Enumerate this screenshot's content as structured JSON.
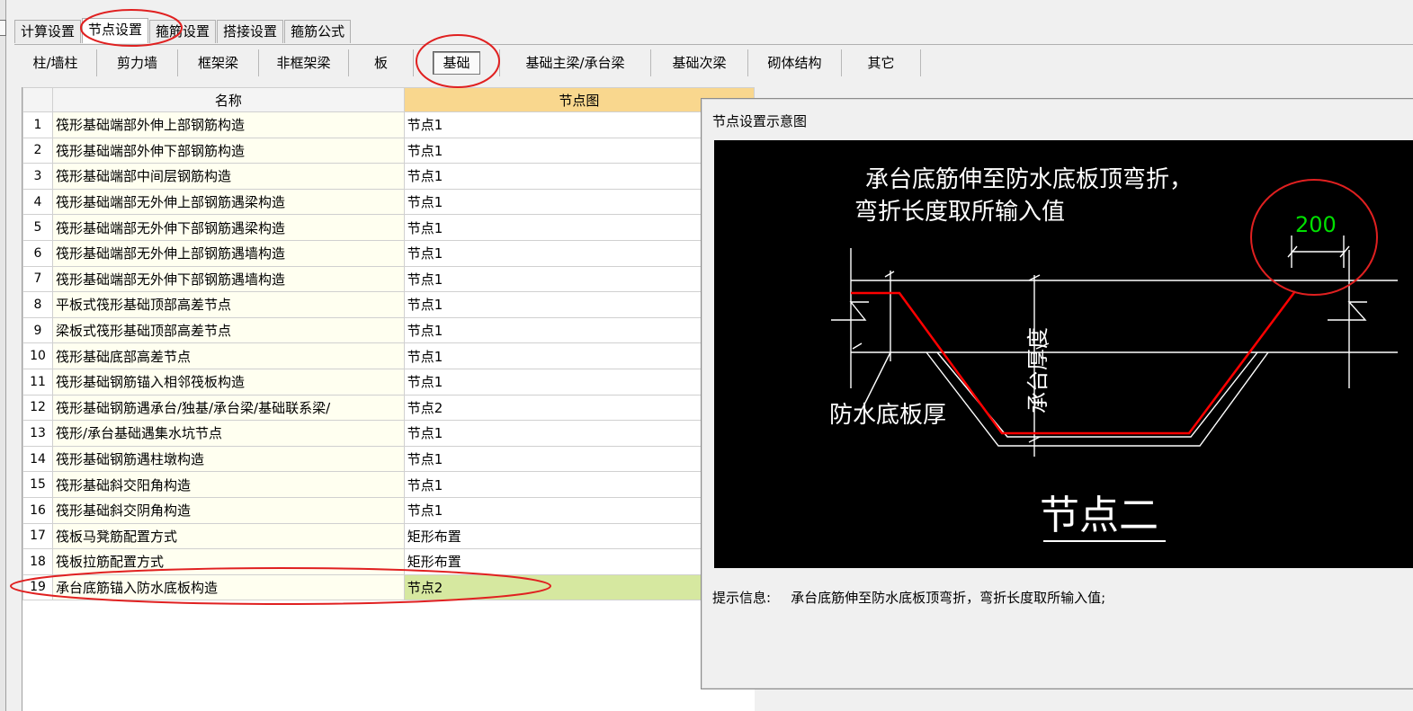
{
  "main_tabs": [
    {
      "label": "计算设置",
      "active": false
    },
    {
      "label": "节点设置",
      "active": true
    },
    {
      "label": "箍筋设置",
      "active": false
    },
    {
      "label": "搭接设置",
      "active": false
    },
    {
      "label": "箍筋公式",
      "active": false
    }
  ],
  "sub_tabs": [
    {
      "label": "柱/墙柱",
      "selected": false
    },
    {
      "label": "剪力墙",
      "selected": false
    },
    {
      "label": "框架梁",
      "selected": false
    },
    {
      "label": "非框架梁",
      "selected": false
    },
    {
      "label": "板",
      "selected": false
    },
    {
      "label": "基础",
      "selected": true
    },
    {
      "label": "基础主梁/承台梁",
      "selected": false
    },
    {
      "label": "基础次梁",
      "selected": false
    },
    {
      "label": "砌体结构",
      "selected": false
    },
    {
      "label": "其它",
      "selected": false
    }
  ],
  "grid": {
    "headers": {
      "name": "名称",
      "node": "节点图"
    },
    "rows": [
      {
        "index": "1",
        "name": "筏形基础端部外伸上部钢筋构造",
        "node": "节点1"
      },
      {
        "index": "2",
        "name": "筏形基础端部外伸下部钢筋构造",
        "node": "节点1"
      },
      {
        "index": "3",
        "name": "筏形基础端部中间层钢筋构造",
        "node": "节点1"
      },
      {
        "index": "4",
        "name": "筏形基础端部无外伸上部钢筋遇梁构造",
        "node": "节点1"
      },
      {
        "index": "5",
        "name": "筏形基础端部无外伸下部钢筋遇梁构造",
        "node": "节点1"
      },
      {
        "index": "6",
        "name": "筏形基础端部无外伸上部钢筋遇墙构造",
        "node": "节点1"
      },
      {
        "index": "7",
        "name": "筏形基础端部无外伸下部钢筋遇墙构造",
        "node": "节点1"
      },
      {
        "index": "8",
        "name": "平板式筏形基础顶部高差节点",
        "node": "节点1"
      },
      {
        "index": "9",
        "name": "梁板式筏形基础顶部高差节点",
        "node": "节点1"
      },
      {
        "index": "10",
        "name": "筏形基础底部高差节点",
        "node": "节点1"
      },
      {
        "index": "11",
        "name": "筏形基础钢筋锚入相邻筏板构造",
        "node": "节点1"
      },
      {
        "index": "12",
        "name": "筏形基础钢筋遇承台/独基/承台梁/基础联系梁/",
        "node": "节点2"
      },
      {
        "index": "13",
        "name": "筏形/承台基础遇集水坑节点",
        "node": "节点1"
      },
      {
        "index": "14",
        "name": "筏形基础钢筋遇柱墩构造",
        "node": "节点1"
      },
      {
        "index": "15",
        "name": "筏形基础斜交阳角构造",
        "node": "节点1"
      },
      {
        "index": "16",
        "name": "筏形基础斜交阴角构造",
        "node": "节点1"
      },
      {
        "index": "17",
        "name": "筏板马凳筋配置方式",
        "node": "矩形布置"
      },
      {
        "index": "18",
        "name": "筏板拉筋配置方式",
        "node": "矩形布置"
      },
      {
        "index": "19",
        "name": "承台底筋锚入防水底板构造",
        "node": "节点2",
        "selected": true
      }
    ]
  },
  "dialog": {
    "title": "节点设置示意图",
    "info_label": "提示信息:",
    "info_text": "承台底筋伸至防水底板顶弯折，弯折长度取所输入值;",
    "diagram": {
      "note_line1": "承台底筋伸至防水底板顶弯折，",
      "note_line2": "弯折长度取所输入值",
      "dimension_value": "200",
      "label_slab": "防水底板厚",
      "label_cap": "承台厚度",
      "node_title": "节点二"
    }
  },
  "colors": {
    "rebar": "#ff0000",
    "dimension_value": "#00e000",
    "node_header": "#f9d78e",
    "selected_cell": "#d6e8a0",
    "annotation": "#e02020"
  }
}
